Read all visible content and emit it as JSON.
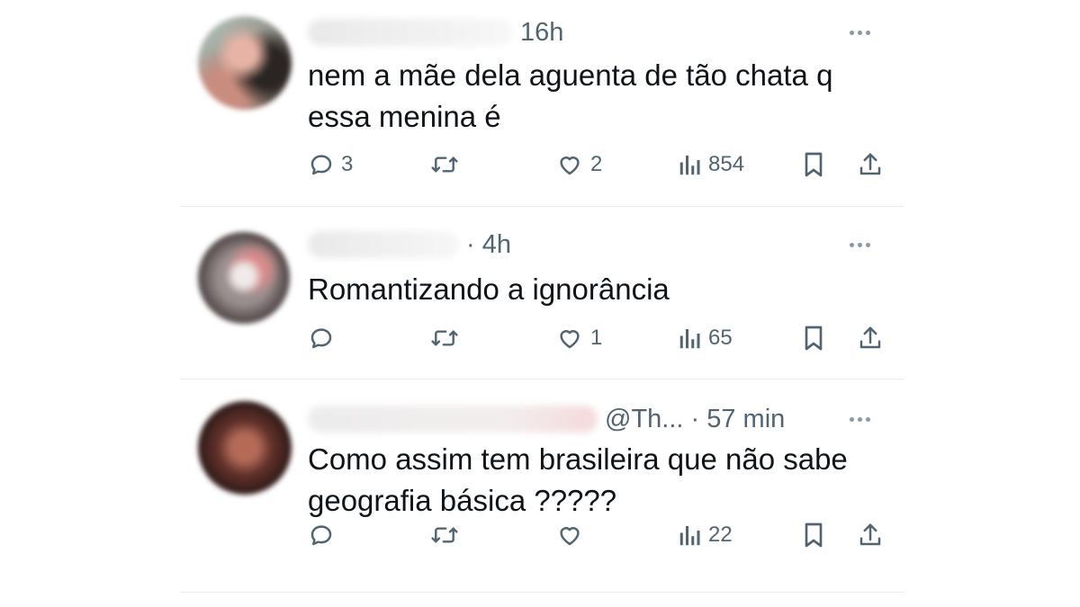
{
  "replies": [
    {
      "time": "16h",
      "text": "nem a mãe dela aguenta de tão chata q\nessa menina é",
      "reply_count": "3",
      "retweet_count": "",
      "like_count": "2",
      "view_count": "854"
    },
    {
      "time": "· 4h",
      "text": "Romantizando a ignorância",
      "reply_count": "",
      "retweet_count": "",
      "like_count": "1",
      "view_count": "65"
    },
    {
      "time": "@Th... · 57 min",
      "text": "Como assim tem brasileira que não sabe\ngeografia básica ?????",
      "reply_count": "",
      "retweet_count": "",
      "like_count": "",
      "view_count": "22"
    }
  ],
  "icons": {
    "reply": "speech-bubble-icon",
    "retweet": "retweet-arrows-icon",
    "like": "heart-icon",
    "views": "bar-chart-icon",
    "bookmark": "bookmark-icon",
    "share": "share-upload-icon",
    "more": "ellipsis-icon"
  },
  "colors": {
    "text": "#0f1419",
    "muted": "#536471",
    "divider": "#e6ecf0"
  }
}
